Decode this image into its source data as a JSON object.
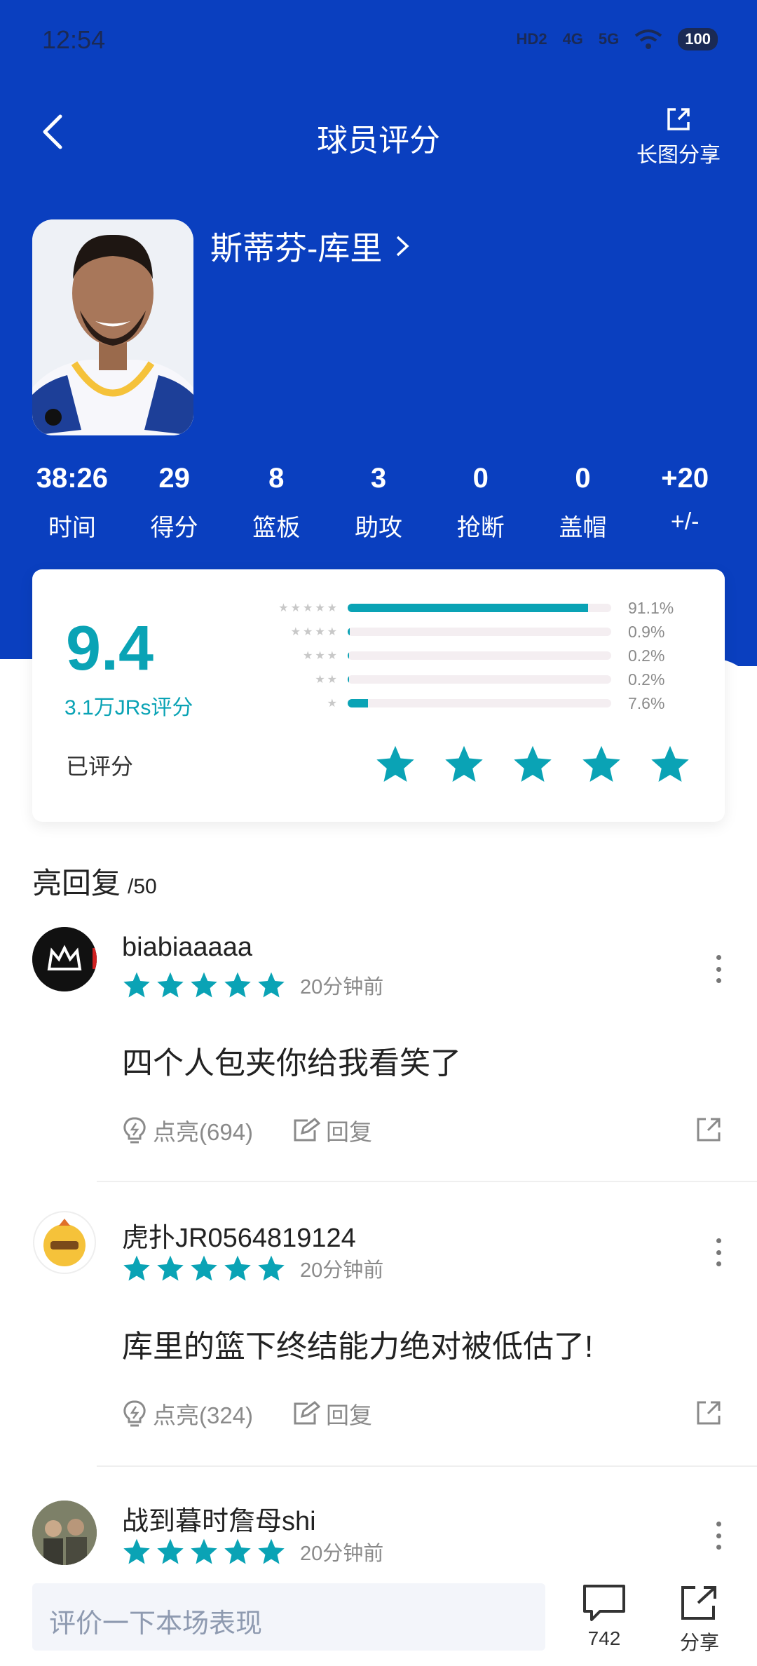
{
  "status": {
    "time": "12:54",
    "net1": "HD2",
    "net2": "4G",
    "net3": "5G",
    "battery": "100"
  },
  "header": {
    "title": "球员评分",
    "share_label": "长图分享"
  },
  "player": {
    "name": "斯蒂芬-库里",
    "stats": [
      {
        "value": "38:26",
        "label": "时间"
      },
      {
        "value": "29",
        "label": "得分"
      },
      {
        "value": "8",
        "label": "篮板"
      },
      {
        "value": "3",
        "label": "助攻"
      },
      {
        "value": "0",
        "label": "抢断"
      },
      {
        "value": "0",
        "label": "盖帽"
      },
      {
        "value": "+20",
        "label": "+/-"
      }
    ]
  },
  "rating": {
    "score": "9.4",
    "count": "3.1万JRs评分",
    "rated_label": "已评分",
    "distribution": [
      {
        "stars": 5,
        "percent": 91.1,
        "label": "91.1%"
      },
      {
        "stars": 4,
        "percent": 0.9,
        "label": "0.9%"
      },
      {
        "stars": 3,
        "percent": 0.2,
        "label": "0.2%"
      },
      {
        "stars": 2,
        "percent": 0.2,
        "label": "0.2%"
      },
      {
        "stars": 1,
        "percent": 7.6,
        "label": "7.6%"
      }
    ],
    "user_stars": 5,
    "accent": "#0aa3b5"
  },
  "replies": {
    "title": "亮回复",
    "count": "/50",
    "items": [
      {
        "user": "biabiaaaaa",
        "time": "20分钟前",
        "text": "四个人包夹你给我看笑了",
        "like_label": "点亮(694)",
        "reply_label": "回复"
      },
      {
        "user": "虎扑JR0564819124",
        "time": "20分钟前",
        "text": "库里的篮下终结能力绝对被低估了!",
        "like_label": "点亮(324)",
        "reply_label": "回复"
      },
      {
        "user": "战到暮时詹母shi",
        "time": "20分钟前"
      }
    ]
  },
  "bottom": {
    "placeholder": "评价一下本场表现",
    "comment_count": "742",
    "share_label": "分享"
  },
  "colors": {
    "header_blue": "#0a3fbf",
    "accent": "#0aa3b5"
  }
}
